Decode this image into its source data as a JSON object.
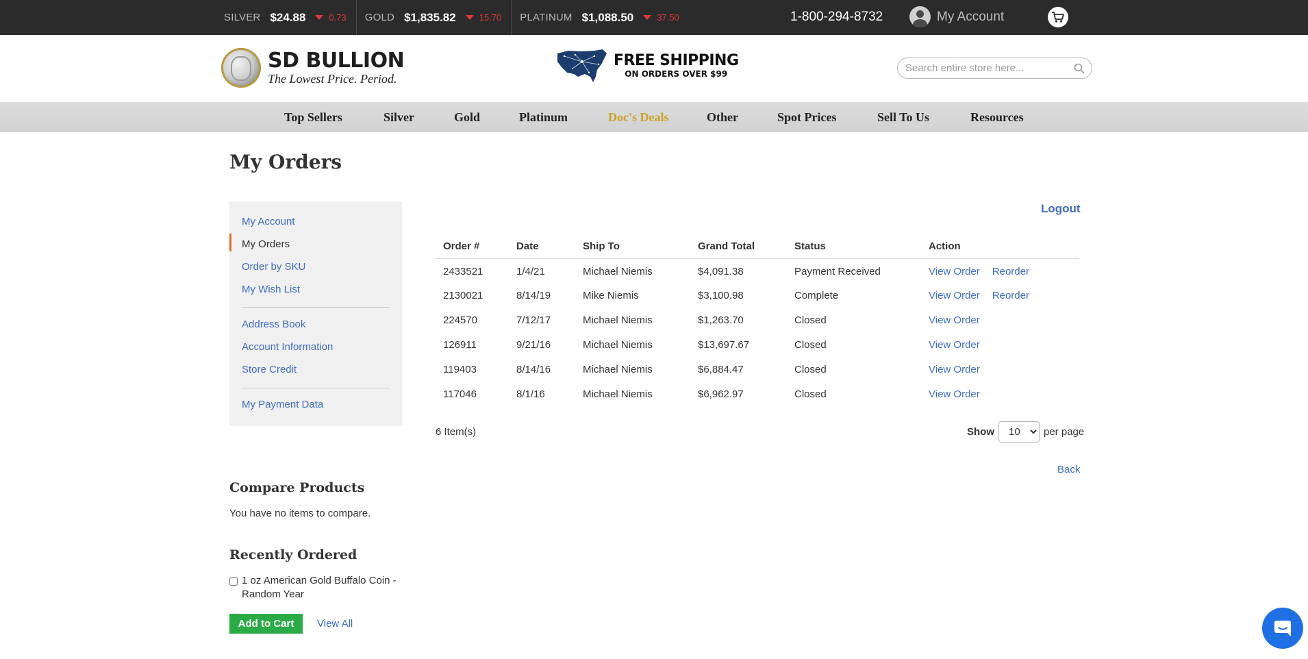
{
  "ticker": [
    {
      "name": "SILVER",
      "price": "$24.88",
      "change": "0.73"
    },
    {
      "name": "GOLD",
      "price": "$1,835.82",
      "change": "15.70"
    },
    {
      "name": "PLATINUM",
      "price": "$1,088.50",
      "change": "37.50"
    }
  ],
  "topbar": {
    "phone": "1-800-294-8732",
    "account_label": "My Account"
  },
  "header": {
    "logo_title": "SD BULLION",
    "logo_tagline": "The Lowest Price. Period.",
    "shipping_big": "FREE SHIPPING",
    "shipping_small": "ON ORDERS OVER $99",
    "search_placeholder": "Search entire store here..."
  },
  "nav": [
    "Top Sellers",
    "Silver",
    "Gold",
    "Platinum",
    "Doc's Deals",
    "Other",
    "Spot Prices",
    "Sell To Us",
    "Resources"
  ],
  "page": {
    "title": "My Orders",
    "logout": "Logout"
  },
  "sidebar": {
    "items": [
      "My Account",
      "My Orders",
      "Order by SKU",
      "My Wish List",
      "Address Book",
      "Account Information",
      "Store Credit",
      "My Payment Data"
    ],
    "active": "My Orders"
  },
  "orders": {
    "headers": [
      "Order #",
      "Date",
      "Ship To",
      "Grand Total",
      "Status",
      "Action"
    ],
    "rows": [
      {
        "order": "2433521",
        "date": "1/4/21",
        "ship_to": "Michael Niemis",
        "total": "$4,091.38",
        "status": "Payment Received",
        "actions": [
          "View Order",
          "Reorder"
        ]
      },
      {
        "order": "2130021",
        "date": "8/14/19",
        "ship_to": "Mike Niemis",
        "total": "$3,100.98",
        "status": "Complete",
        "actions": [
          "View Order",
          "Reorder"
        ]
      },
      {
        "order": "224570",
        "date": "7/12/17",
        "ship_to": "Michael Niemis",
        "total": "$1,263.70",
        "status": "Closed",
        "actions": [
          "View Order"
        ]
      },
      {
        "order": "126911",
        "date": "9/21/16",
        "ship_to": "Michael Niemis",
        "total": "$13,697.67",
        "status": "Closed",
        "actions": [
          "View Order"
        ]
      },
      {
        "order": "119403",
        "date": "8/14/16",
        "ship_to": "Michael Niemis",
        "total": "$6,884.47",
        "status": "Closed",
        "actions": [
          "View Order"
        ]
      },
      {
        "order": "117046",
        "date": "8/1/16",
        "ship_to": "Michael Niemis",
        "total": "$6,962.97",
        "status": "Closed",
        "actions": [
          "View Order"
        ]
      }
    ],
    "count_label": "6 Item(s)",
    "show_label": "Show",
    "per_page_value": "10",
    "per_page_suffix": "per page",
    "back_label": "Back"
  },
  "compare": {
    "title": "Compare Products",
    "empty_text": "You have no items to compare."
  },
  "recent": {
    "title": "Recently Ordered",
    "item": "1 oz American Gold Buffalo Coin - Random Year",
    "add_to_cart": "Add to Cart",
    "view_all": "View All"
  },
  "colors": {
    "link": "#3f6bc4",
    "deal": "#c9a227",
    "down": "#e0383e",
    "add_to_cart": "#2bab45",
    "chat": "#1f6fe5"
  }
}
